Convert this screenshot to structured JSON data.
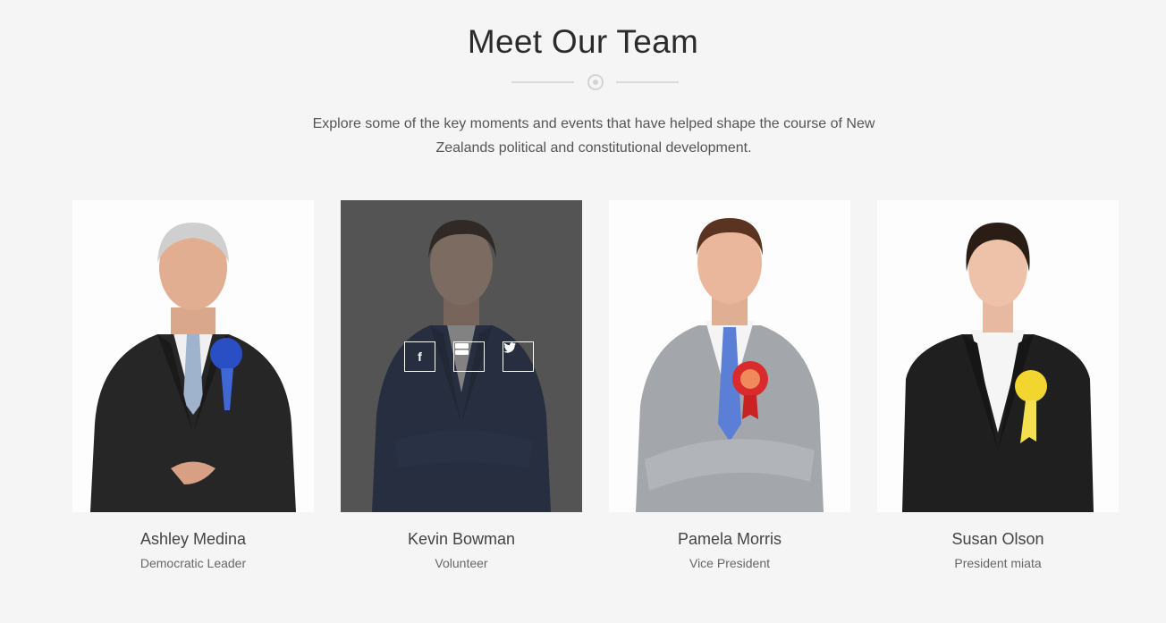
{
  "section": {
    "title": "Meet Our Team",
    "intro": "Explore some of the key moments and events that have helped shape the course of New Zealands political and constitutional development."
  },
  "members": [
    {
      "name": "Ashley Medina",
      "role": "Democratic Leader",
      "ribbon_color": "#2a4fc4"
    },
    {
      "name": "Kevin Bowman",
      "role": "Volunteer",
      "ribbon_color": "#1e2d52"
    },
    {
      "name": "Pamela Morris",
      "role": "Vice President",
      "ribbon_color": "#d92b2b"
    },
    {
      "name": "Susan Olson",
      "role": "President miata",
      "ribbon_color": "#f2d52e"
    }
  ],
  "social": {
    "facebook": "f",
    "youtube": "You Tube",
    "twitter": "twitter"
  },
  "colors": {
    "background": "#f5f5f5",
    "overlay": "#5a5a5a",
    "heading": "#2b2b2b"
  }
}
